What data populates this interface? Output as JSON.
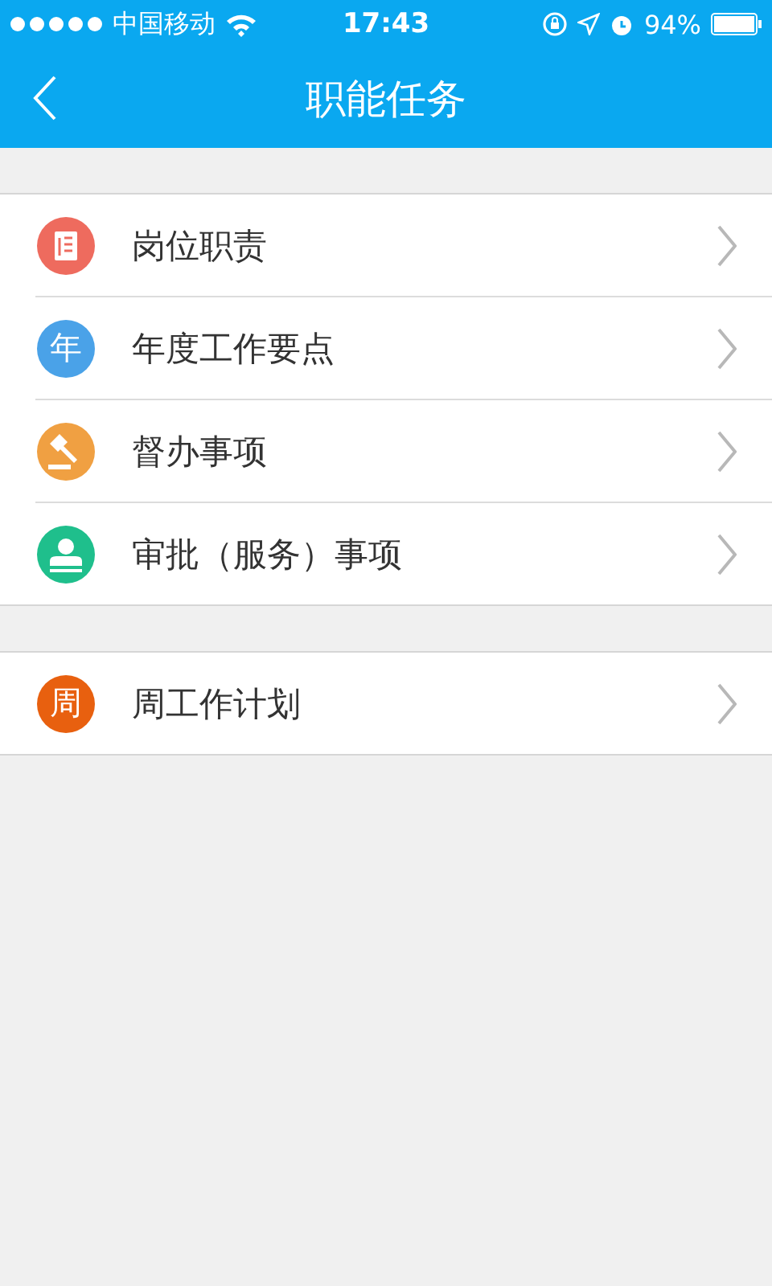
{
  "status_bar": {
    "carrier": "中国移动",
    "time": "17:43",
    "battery": "94%"
  },
  "nav_bar": {
    "title": "职能任务"
  },
  "groups": [
    {
      "items": [
        {
          "label": "岗位职责",
          "icon": {
            "kind": "document",
            "color": "#ee6b5e"
          }
        },
        {
          "label": "年度工作要点",
          "icon": {
            "kind": "glyph",
            "text": "年",
            "color": "#4aa2e8"
          }
        },
        {
          "label": "督办事项",
          "icon": {
            "kind": "gavel",
            "color": "#f0a042"
          }
        },
        {
          "label": "审批（服务）事项",
          "icon": {
            "kind": "stamp",
            "color": "#1fbf8c"
          }
        }
      ]
    },
    {
      "items": [
        {
          "label": "周工作计划",
          "icon": {
            "kind": "glyph",
            "text": "周",
            "color": "#e8600f"
          }
        }
      ]
    }
  ]
}
